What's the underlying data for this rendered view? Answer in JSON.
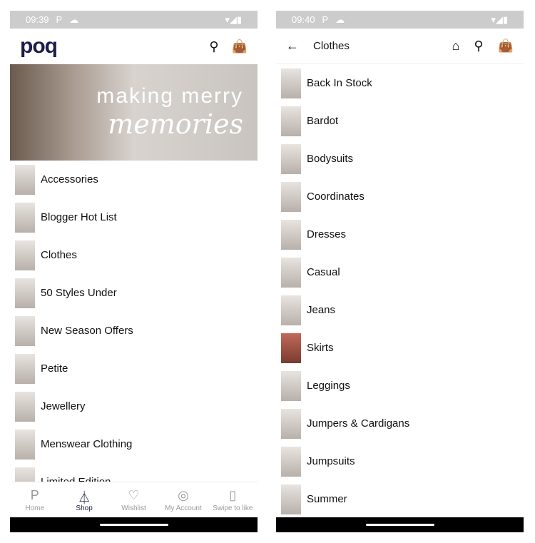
{
  "left": {
    "status": {
      "time": "09:39"
    },
    "logo": "poq",
    "banner": {
      "line1": "making merry",
      "line2": "memories"
    },
    "items": [
      "Accessories",
      "Blogger Hot List",
      "Clothes",
      "50 Styles Under",
      "New Season Offers",
      "Petite",
      "Jewellery",
      "Menswear Clothing",
      "Limited Edition"
    ],
    "nav": [
      {
        "label": "Home",
        "icon": "p-logo"
      },
      {
        "label": "Shop",
        "icon": "hanger"
      },
      {
        "label": "Wishlist",
        "icon": "heart"
      },
      {
        "label": "My Account",
        "icon": "user-circle"
      },
      {
        "label": "Swipe to like",
        "icon": "cards"
      }
    ]
  },
  "right": {
    "status": {
      "time": "09:40"
    },
    "title": "Clothes",
    "items": [
      "Back In Stock",
      "Bardot",
      "Bodysuits",
      "Coordinates",
      "Dresses",
      "Casual",
      "Jeans",
      "Skirts",
      "Leggings",
      "Jumpers & Cardigans",
      "Jumpsuits",
      "Summer"
    ]
  },
  "colors": {
    "brand": "#1c1c4e",
    "status_bar": "#cccccc"
  }
}
